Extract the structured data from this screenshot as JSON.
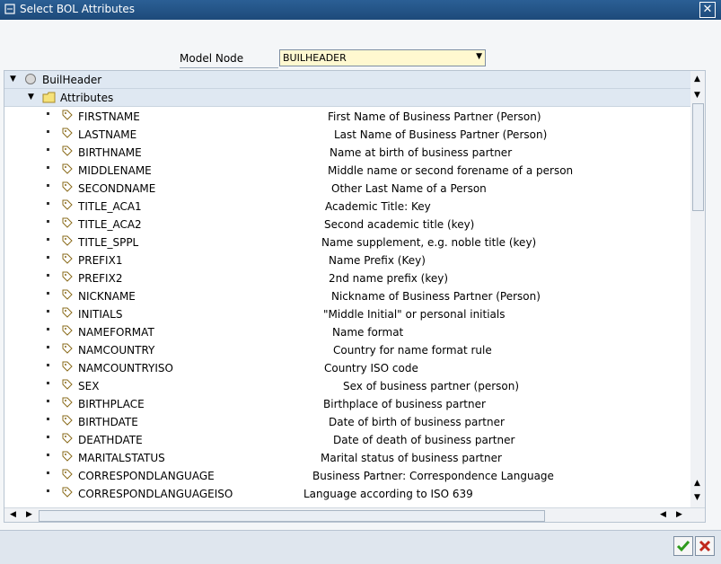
{
  "window": {
    "title": "Select BOL Attributes"
  },
  "model_node": {
    "label": "Model Node",
    "value": "BUILHEADER"
  },
  "tree": {
    "root": "BuilHeader",
    "folder": "Attributes",
    "items": [
      {
        "name": "FIRSTNAME",
        "desc": "First Name of Business Partner (Person)"
      },
      {
        "name": "LASTNAME",
        "desc": "Last Name of Business Partner (Person)"
      },
      {
        "name": "BIRTHNAME",
        "desc": "Name at birth of business partner"
      },
      {
        "name": "MIDDLENAME",
        "desc": "Middle name or second forename of a person"
      },
      {
        "name": "SECONDNAME",
        "desc": "Other Last Name of a Person"
      },
      {
        "name": "TITLE_ACA1",
        "desc": "Academic Title: Key"
      },
      {
        "name": "TITLE_ACA2",
        "desc": "Second academic title (key)"
      },
      {
        "name": "TITLE_SPPL",
        "desc": "Name supplement, e.g. noble title (key)"
      },
      {
        "name": "PREFIX1",
        "desc": "Name Prefix (Key)"
      },
      {
        "name": "PREFIX2",
        "desc": "2nd name prefix (key)"
      },
      {
        "name": "NICKNAME",
        "desc": "Nickname of Business Partner (Person)"
      },
      {
        "name": "INITIALS",
        "desc": "\"Middle Initial\" or personal initials"
      },
      {
        "name": "NAMEFORMAT",
        "desc": "Name format"
      },
      {
        "name": "NAMCOUNTRY",
        "desc": "Country for name format rule"
      },
      {
        "name": "NAMCOUNTRYISO",
        "desc": "Country ISO code"
      },
      {
        "name": "SEX",
        "desc": "Sex of business partner (person)"
      },
      {
        "name": "BIRTHPLACE",
        "desc": "Birthplace of business partner"
      },
      {
        "name": "BIRTHDATE",
        "desc": "Date of birth of business partner"
      },
      {
        "name": "DEATHDATE",
        "desc": "Date of death of business partner"
      },
      {
        "name": "MARITALSTATUS",
        "desc": "Marital status of business partner"
      },
      {
        "name": "CORRESPONDLANGUAGE",
        "desc": "Business Partner: Correspondence Language"
      },
      {
        "name": "CORRESPONDLANGUAGEISO",
        "desc": "Language according to ISO 639"
      }
    ]
  },
  "buttons": {
    "ok_icon": "checkmark-icon",
    "cancel_icon": "cancel-x-icon"
  },
  "colors": {
    "title_bar": "#1d4a7a",
    "select_bg": "#fff8d0",
    "ok_green": "#2e9a1c",
    "cancel_red": "#c0281c"
  }
}
